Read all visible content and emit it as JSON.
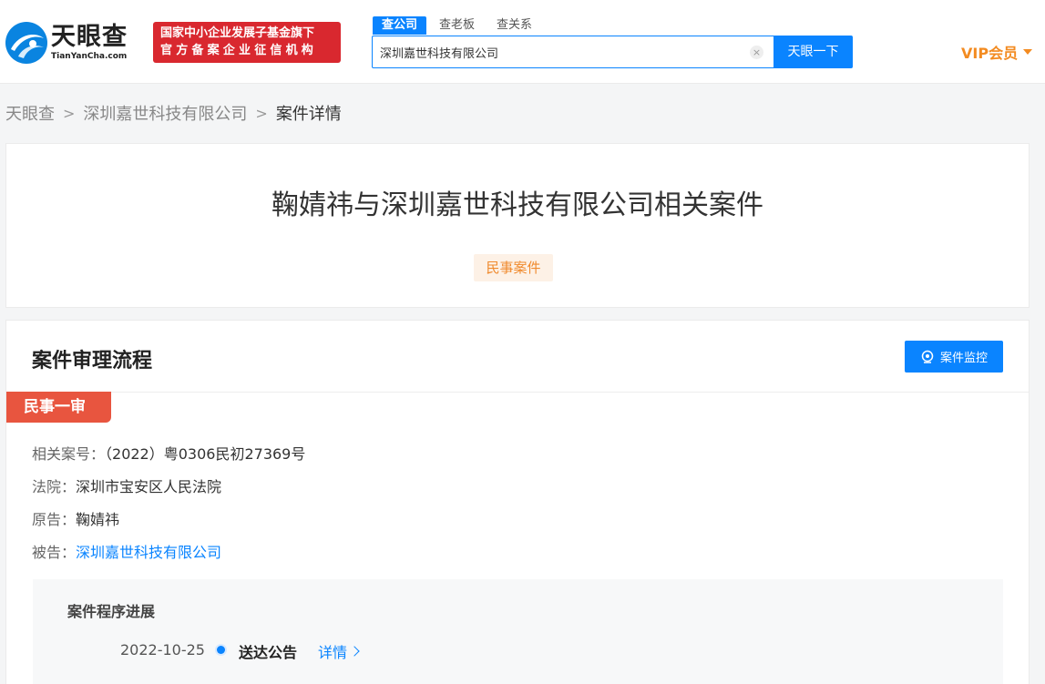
{
  "header": {
    "logo_cn": "天眼查",
    "logo_en": "TianYanCha.com",
    "badge_line1": "国家中小企业发展子基金旗下",
    "badge_line2": "官方备案企业征信机构",
    "tabs": [
      {
        "label": "查公司"
      },
      {
        "label": "查老板"
      },
      {
        "label": "查关系"
      }
    ],
    "search_value": "深圳嘉世科技有限公司",
    "search_button": "天眼一下",
    "vip_label": "VIP会员",
    "brand_color": "#0a84ff"
  },
  "breadcrumb": {
    "items": [
      "天眼查",
      "深圳嘉世科技有限公司",
      "案件详情"
    ]
  },
  "case": {
    "title": "鞠婧祎与深圳嘉世科技有限公司相关案件",
    "type_tag": "民事案件"
  },
  "process": {
    "section_title": "案件审理流程",
    "monitor_button": "案件监控",
    "stage": "民事一审",
    "fields": {
      "case_no_label": "相关案号：",
      "case_no": "（2022）粤0306民初27369号",
      "court_label": "法院：",
      "court": "深圳市宝安区人民法院",
      "plaintiff_label": "原告：",
      "plaintiff": "鞠婧祎",
      "defendant_label": "被告：",
      "defendant": "深圳嘉世科技有限公司"
    },
    "progress": {
      "title": "案件程序进展",
      "items": [
        {
          "date": "2022-10-25",
          "event": "送达公告",
          "detail": "详情"
        }
      ]
    }
  }
}
